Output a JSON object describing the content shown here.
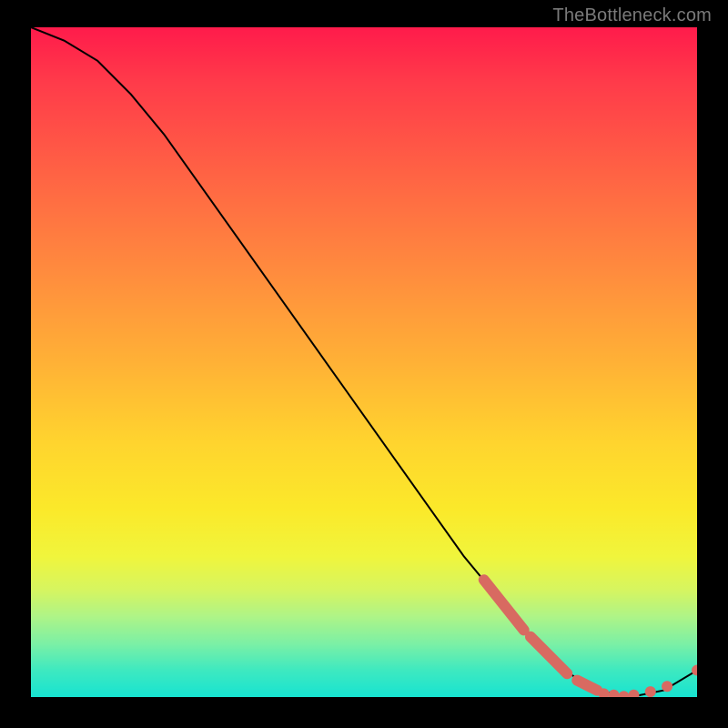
{
  "watermark": "TheBottleneck.com",
  "chart_data": {
    "type": "line",
    "title": "",
    "xlabel": "",
    "ylabel": "",
    "xlim": [
      0,
      100
    ],
    "ylim": [
      0,
      100
    ],
    "series": [
      {
        "name": "curve",
        "x": [
          0,
          5,
          10,
          15,
          20,
          25,
          30,
          35,
          40,
          45,
          50,
          55,
          60,
          65,
          70,
          75,
          80,
          85,
          90,
          95,
          100
        ],
        "y": [
          100,
          98,
          95,
          90,
          84,
          77,
          70,
          63,
          56,
          49,
          42,
          35,
          28,
          21,
          15,
          9,
          4,
          1,
          0,
          1,
          4
        ]
      }
    ],
    "highlight_segments": [
      [
        68,
        17.5,
        74,
        10
      ],
      [
        75,
        9,
        80.5,
        3.5
      ],
      [
        82,
        2.5,
        85,
        1
      ]
    ],
    "highlight_points": [
      [
        86,
        0.5
      ],
      [
        87.5,
        0.3
      ],
      [
        89,
        0.1
      ],
      [
        90.5,
        0.3
      ],
      [
        93,
        0.8
      ],
      [
        95.5,
        1.6
      ],
      [
        100,
        4
      ]
    ],
    "colors": {
      "curve": "#000000",
      "highlight": "#d86a61"
    }
  }
}
